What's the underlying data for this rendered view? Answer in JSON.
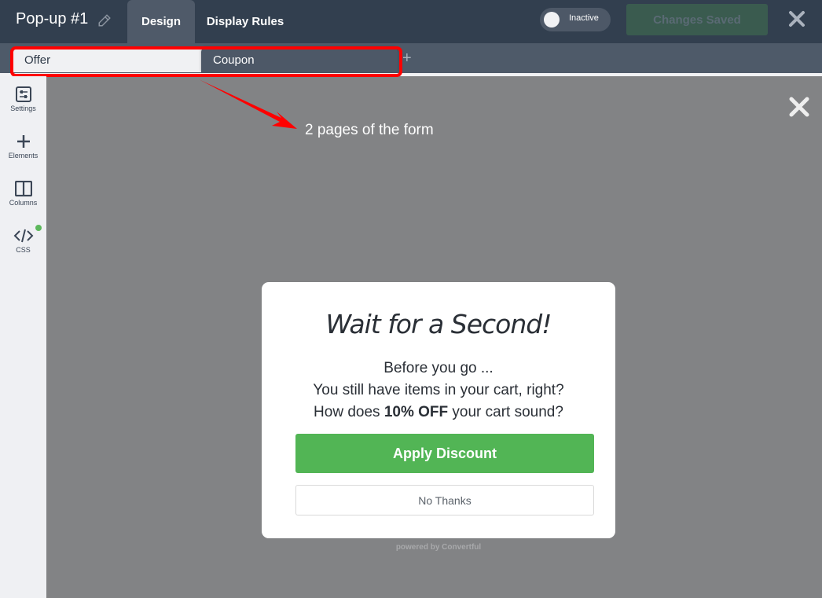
{
  "header": {
    "title": "Pop-up #1",
    "tabs": [
      {
        "label": "Design",
        "active": true
      },
      {
        "label": "Display Rules",
        "active": false
      }
    ],
    "status_toggle": {
      "label": "Inactive",
      "on": false
    },
    "save_label": "Changes Saved",
    "icons": {
      "edit": "pencil-icon",
      "close": "close-icon"
    }
  },
  "pages": {
    "tabs": [
      {
        "label": "Offer",
        "active": true
      },
      {
        "label": "Coupon",
        "active": false
      }
    ],
    "add_label": "+"
  },
  "sidebar": {
    "items": [
      {
        "label": "Settings",
        "icon": "sliders-icon"
      },
      {
        "label": "Elements",
        "icon": "plus-icon"
      },
      {
        "label": "Columns",
        "icon": "columns-icon"
      },
      {
        "label": "CSS",
        "icon": "code-icon",
        "indicator": "active"
      }
    ]
  },
  "annotation": {
    "text": "2 pages of the form",
    "color": "#ff0000"
  },
  "popup": {
    "title": "Wait for a Second!",
    "lines": {
      "line1": "Before you go ...",
      "line2": "You still have items in your cart, right?",
      "line3_prefix": "How does ",
      "line3_bold": "10% OFF",
      "line3_suffix": " your cart sound?"
    },
    "primary_button": "Apply Discount",
    "secondary_button": "No Thanks",
    "powered_by": "powered by Convertful",
    "accent_color": "#52b555"
  }
}
